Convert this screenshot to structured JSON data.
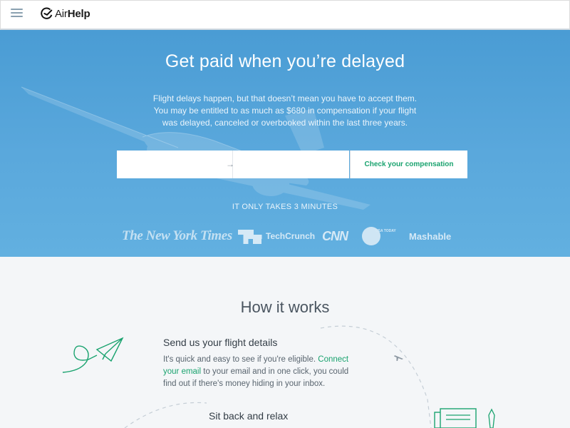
{
  "header": {
    "logo_text_prefix": "Air",
    "logo_text_bold": "Help"
  },
  "hero": {
    "title": "Get paid when you’re delayed",
    "description": "Flight delays happen, but that doesn’t mean you have to accept them. You may be entitled to as much as $680 in compensation if your flight was delayed, canceled or overbooked within the last three years.",
    "from_placeholder": "",
    "to_placeholder": "",
    "arrow": "→",
    "cta_label": "Check your compensation",
    "note": "IT ONLY TAKES 3 MINUTES",
    "press": {
      "nyt": "The New York Times",
      "techcrunch": "TechCrunch",
      "cnn": "CNN",
      "usatoday": "USA TODAY",
      "mashable": "Mashable"
    }
  },
  "how": {
    "title": "How it works",
    "step1": {
      "title": "Send us your flight details",
      "text_before": "It's quick and easy to see if you're eligible. ",
      "link": "Connect your email",
      "text_after": " to your email and in one click, you could find out if there's money hiding in your inbox."
    },
    "step2": {
      "title": "Sit back and relax"
    }
  },
  "colors": {
    "accent": "#1aa36f",
    "hero_blue": "#4f9fd6",
    "page_bg": "#f4f6f8"
  }
}
